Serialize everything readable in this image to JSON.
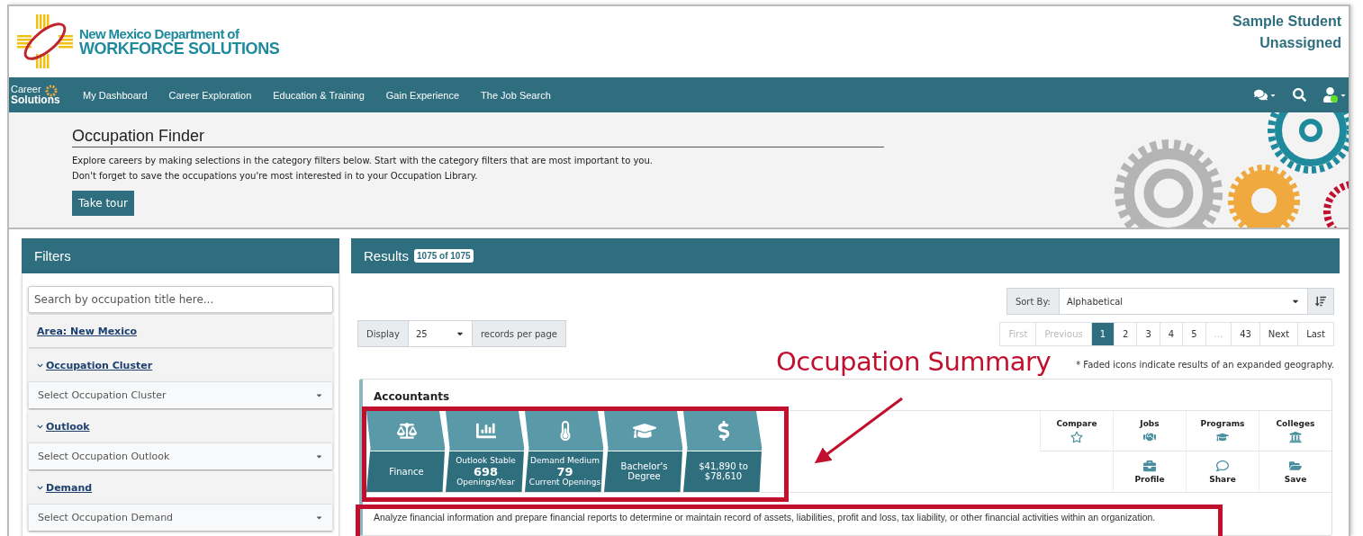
{
  "header": {
    "logo": {
      "line1": "New Mexico Department of",
      "line2": "WORKFORCE SOLUTIONS"
    },
    "user": {
      "name": "Sample Student",
      "status": "Unassigned"
    }
  },
  "nav": {
    "brand": {
      "line1": "Career",
      "line2": "Solutions"
    },
    "items": [
      "My Dashboard",
      "Career Exploration",
      "Education & Training",
      "Gain Experience",
      "The Job Search"
    ]
  },
  "hero": {
    "title": "Occupation Finder",
    "lines": [
      "Explore careers by making selections in the category filters below. Start with the category filters that are most important to you.",
      "Don't forget to save the occupations you're most interested in to your Occupation Library."
    ],
    "button": "Take tour"
  },
  "filters": {
    "title": "Filters",
    "search": {
      "placeholder": "Search by occupation title here..."
    },
    "area": "Area: New Mexico",
    "groups": [
      {
        "label": "Occupation Cluster",
        "expanded": true,
        "placeholder": "Select Occupation Cluster"
      },
      {
        "label": "Outlook",
        "expanded": true,
        "placeholder": "Select Occupation Outlook"
      },
      {
        "label": "Demand",
        "expanded": true,
        "placeholder": "Select Occupation Demand"
      }
    ]
  },
  "results": {
    "title": "Results",
    "count": "1075 of 1075",
    "sort": {
      "label": "Sort By:",
      "value": "Alphabetical"
    },
    "display": {
      "label": "Display",
      "value": "25",
      "suffix": "records per page"
    },
    "pagination": [
      {
        "label": "First",
        "selected": false,
        "disabled": true
      },
      {
        "label": "Previous",
        "selected": false,
        "disabled": true
      },
      {
        "label": "1",
        "selected": true,
        "disabled": false
      },
      {
        "label": "2",
        "selected": false,
        "disabled": false
      },
      {
        "label": "3",
        "selected": false,
        "disabled": false
      },
      {
        "label": "4",
        "selected": false,
        "disabled": false
      },
      {
        "label": "5",
        "selected": false,
        "disabled": false
      },
      {
        "label": "...",
        "selected": false,
        "disabled": true
      },
      {
        "label": "43",
        "selected": false,
        "disabled": false
      },
      {
        "label": "Next",
        "selected": false,
        "disabled": false
      },
      {
        "label": "Last",
        "selected": false,
        "disabled": false
      }
    ],
    "note": "* Faded icons indicate results of an expanded geography.",
    "card": {
      "title": "Accountants",
      "tiles": [
        {
          "kind": "cluster",
          "label": "Finance"
        },
        {
          "kind": "outlook",
          "caption": "Outlook Stable",
          "value": "698",
          "sub": "Openings/Year"
        },
        {
          "kind": "demand",
          "caption": "Demand Medium",
          "value": "79",
          "sub": "Current Openings"
        },
        {
          "kind": "education",
          "label": "Bachelor's Degree"
        },
        {
          "kind": "wage",
          "label": "$41,890 to $78,610"
        }
      ],
      "top_actions": [
        {
          "kind": "compare",
          "label": "Compare"
        },
        {
          "kind": "jobs",
          "label": "Jobs"
        },
        {
          "kind": "programs",
          "label": "Programs"
        },
        {
          "kind": "colleges",
          "label": "Colleges"
        }
      ],
      "bottom_actions": [
        {
          "kind": "profile",
          "label": "Profile"
        },
        {
          "kind": "share",
          "label": "Share"
        },
        {
          "kind": "save",
          "label": "Save"
        }
      ],
      "description": "Analyze financial information and prepare financial reports to determine or maintain record of assets, liabilities, profit and loss, tax liability, or other financial activities within an organization."
    }
  },
  "annotation": {
    "label": "Occupation Summary"
  }
}
